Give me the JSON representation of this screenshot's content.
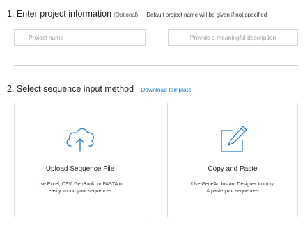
{
  "section1": {
    "title": "1. Enter project information",
    "optional": "(Optional)",
    "hint": "Default project name will be given if not specified",
    "project_name_placeholder": "Project name",
    "description_placeholder": "Provide a meaningful description"
  },
  "section2": {
    "title": "2. Select sequence input method",
    "download_link": "Download template"
  },
  "cards": {
    "upload": {
      "icon": "cloud-upload-icon",
      "title": "Upload Sequence File",
      "desc_line1": "Use Excel, CSV, GenBank, or FASTA to",
      "desc_line2": "easily import your sequences"
    },
    "paste": {
      "icon": "edit-icon",
      "title": "Copy and Paste",
      "desc_line1": "Use GeneArt Instant Designer to copy",
      "desc_line2": "& paste your sequences"
    }
  },
  "colors": {
    "accent": "#1f7ac8",
    "border": "#d7d7d7",
    "text": "#222222"
  }
}
